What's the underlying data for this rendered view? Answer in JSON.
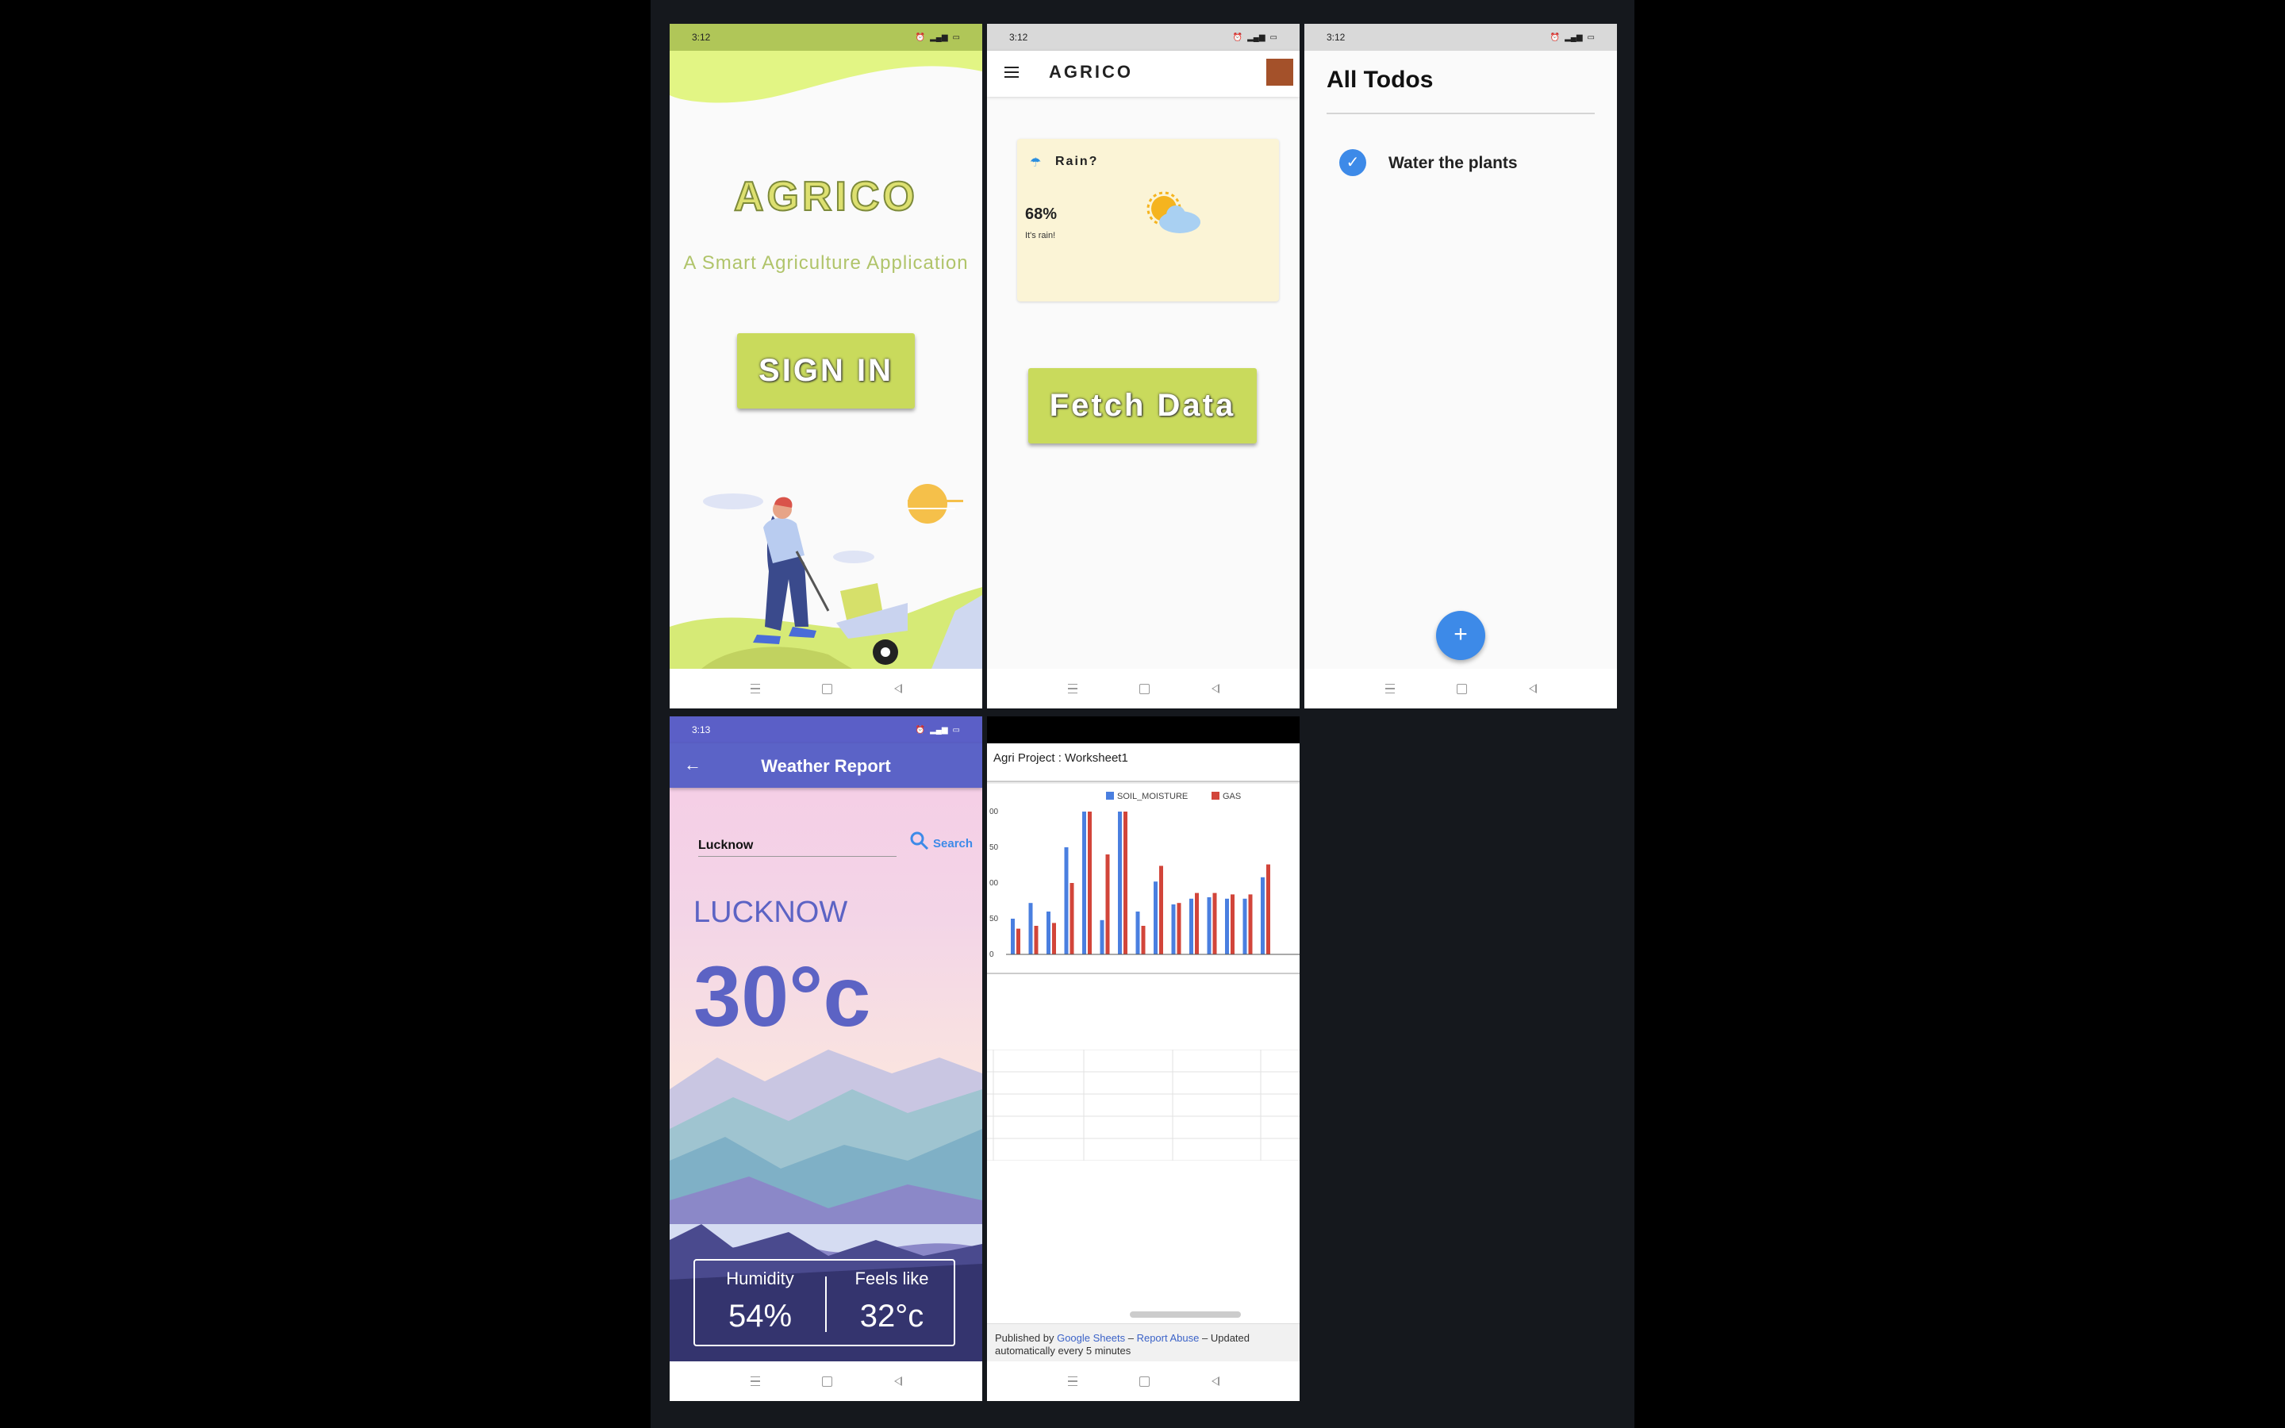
{
  "screens": {
    "signin": {
      "time": "3:12",
      "brand": "AGRICO",
      "tagline": "A Smart Agriculture Application",
      "button": "SIGN IN"
    },
    "dashboard": {
      "time": "3:12",
      "app_title": "AGRICO",
      "weather_card": {
        "title": "Rain?",
        "percent": "68%",
        "message": "It's rain!"
      },
      "button": "Fetch Data"
    },
    "todos": {
      "time": "3:12",
      "title": "All Todos",
      "items": [
        {
          "text": "Water the plants",
          "done": true
        }
      ],
      "fab": "+"
    },
    "weather": {
      "time": "3:13",
      "title": "Weather Report",
      "search": {
        "value": "Lucknow",
        "label": "Search"
      },
      "city": "LUCKNOW",
      "temperature": "30°c",
      "humidity": {
        "label": "Humidity",
        "value": "54%"
      },
      "feels_like": {
        "label": "Feels like",
        "value": "32°c"
      }
    },
    "sheet": {
      "title": "Agri Project : Worksheet1",
      "footer": {
        "published_by": "Published by",
        "source_link": "Google Sheets",
        "sep1": "–",
        "report_link": "Report Abuse",
        "sep2": "–",
        "updated": "Updated automatically every 5 minutes"
      }
    }
  },
  "colors": {
    "accent_green": "#c9da5c",
    "fab_blue": "#3d8ae8",
    "weather_purple": "#5b63c7",
    "soil_series": "#4a7fe0",
    "gas_series": "#d2453a"
  },
  "chart_data": {
    "type": "bar",
    "legend": [
      "SOIL_MOISTURE",
      "GAS"
    ],
    "legend_position": "top",
    "y_ticks": [
      "0",
      "50",
      "00",
      "50",
      "00"
    ],
    "series": [
      {
        "name": "SOIL_MOISTURE",
        "values": [
          50,
          72,
          60,
          150,
          200,
          48,
          200,
          60,
          102,
          70,
          78,
          80,
          78,
          78,
          108
        ]
      },
      {
        "name": "GAS",
        "values": [
          36,
          40,
          44,
          100,
          200,
          140,
          200,
          40,
          124,
          72,
          86,
          86,
          84,
          84,
          126
        ]
      }
    ],
    "ylim": [
      0,
      200
    ]
  }
}
